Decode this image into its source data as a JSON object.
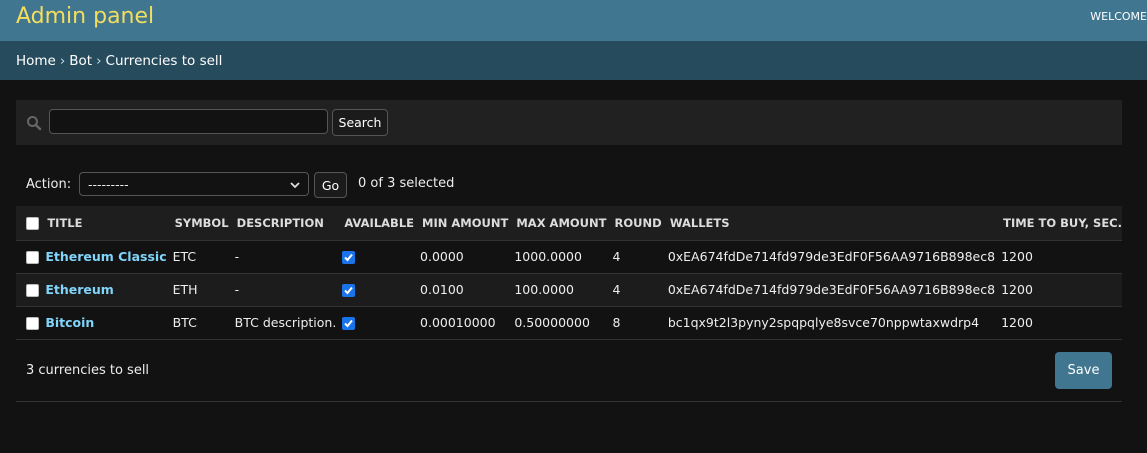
{
  "header": {
    "site_title": "Admin panel",
    "user_tools": "WELCOME"
  },
  "breadcrumbs": [
    "Home",
    "Bot",
    "Currencies to sell"
  ],
  "search": {
    "value": "",
    "button_label": "Search"
  },
  "actions": {
    "label": "Action:",
    "selected_value": "---------",
    "go_label": "Go",
    "selected_count": "0 of 3 selected"
  },
  "table": {
    "columns": [
      "TITLE",
      "SYMBOL",
      "DESCRIPTION",
      "AVAILABLE",
      "MIN AMOUNT",
      "MAX AMOUNT",
      "ROUND",
      "WALLETS",
      "TIME TO BUY, SEC."
    ],
    "rows": [
      {
        "title": "Ethereum Classic",
        "symbol": "ETC",
        "description": "-",
        "available": true,
        "min_amount": "0.0000",
        "max_amount": "1000.0000",
        "round": "4",
        "wallets": "0xEA674fdDe714fd979de3EdF0F56AA9716B898ec8",
        "time": "1200"
      },
      {
        "title": "Ethereum",
        "symbol": "ETH",
        "description": "-",
        "available": true,
        "min_amount": "0.0100",
        "max_amount": "100.0000",
        "round": "4",
        "wallets": "0xEA674fdDe714fd979de3EdF0F56AA9716B898ec8",
        "time": "1200"
      },
      {
        "title": "Bitcoin",
        "symbol": "BTC",
        "description": "BTC description.",
        "available": true,
        "min_amount": "0.00010000",
        "max_amount": "0.50000000",
        "round": "8",
        "wallets": "bc1qx9t2l3pyny2spqpqlye8svce70nppwtaxwdrp4",
        "time": "1200"
      }
    ]
  },
  "footer": {
    "paginator": "3 currencies to sell",
    "save_label": "Save"
  },
  "colors": {
    "header_bg": "#417690",
    "breadcrumb_bg": "#264b5d",
    "title_color": "#f5dd5d",
    "link_color": "#81d4fa",
    "page_bg": "#121212"
  }
}
